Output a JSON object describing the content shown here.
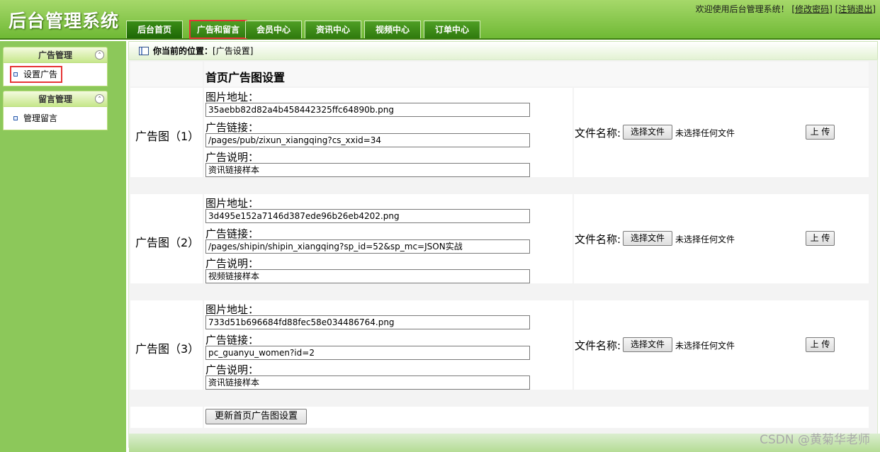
{
  "app": {
    "title": "后台管理系统"
  },
  "header": {
    "welcome": "欢迎使用后台管理系统！",
    "change_password": "[修改密码]",
    "logout": "[注销退出]"
  },
  "nav": {
    "tabs": [
      {
        "label": "后台首页"
      },
      {
        "label": "广告和留言"
      },
      {
        "label": "会员中心"
      },
      {
        "label": "资讯中心"
      },
      {
        "label": "视频中心"
      },
      {
        "label": "订单中心"
      }
    ]
  },
  "sidebar": {
    "sections": [
      {
        "title": "广告管理",
        "items": [
          {
            "label": "设置广告"
          }
        ]
      },
      {
        "title": "留言管理",
        "items": [
          {
            "label": "管理留言"
          }
        ]
      }
    ]
  },
  "breadcrumb": {
    "prefix": "你当前的位置：",
    "current": "[广告设置]"
  },
  "form": {
    "title": "首页广告图设置",
    "field_labels": {
      "image": "图片地址：",
      "link": "广告链接：",
      "desc": "广告说明："
    },
    "file_label": "文件名称:",
    "choose_file": "选择文件",
    "no_file": "未选择任何文件",
    "upload": "上 传",
    "submit": "更新首页广告图设置",
    "ads": [
      {
        "label": "广告图（1）",
        "image": "35aebb82d82a4b458442325ffc64890b.png",
        "link": "/pages/pub/zixun_xiangqing?cs_xxid=34",
        "desc": "资讯链接样本"
      },
      {
        "label": "广告图（2）",
        "image": "3d495e152a7146d387ede96b26eb4202.png",
        "link": "/pages/shipin/shipin_xiangqing?sp_id=52&sp_mc=JSON实战",
        "desc": "视频链接样本"
      },
      {
        "label": "广告图（3）",
        "image": "733d51b696684fd88fec58e034486764.png",
        "link": "pc_guanyu_women?id=2",
        "desc": "资讯链接样本"
      }
    ]
  },
  "watermark": "CSDN @黄菊华老师"
}
